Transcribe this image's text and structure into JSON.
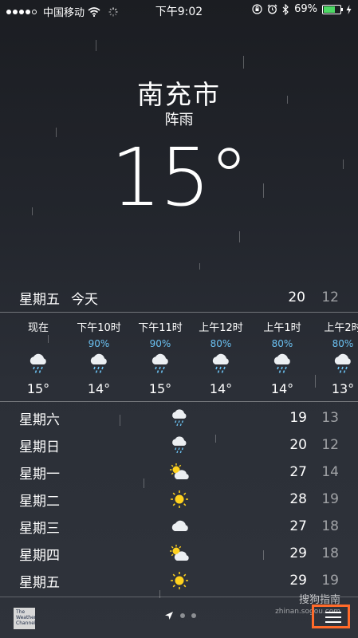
{
  "status": {
    "carrier": "中国移动",
    "time": "下午9:02",
    "battery": "69%",
    "battery_level": 0.69,
    "icons": [
      "signal-dots-icon",
      "wifi-icon",
      "activity-spinner-icon",
      "orientation-lock-icon",
      "alarm-icon",
      "bluetooth-icon",
      "battery-icon",
      "charging-bolt-icon"
    ]
  },
  "location": {
    "city": "南充市",
    "condition": "阵雨",
    "temp": "15°"
  },
  "today": {
    "day": "星期五",
    "label": "今天",
    "high": "20",
    "low": "12"
  },
  "hourly": [
    {
      "time": "现在",
      "precip": "",
      "icon": "rain-cloud-icon",
      "temp": "15°"
    },
    {
      "time": "下午10时",
      "precip": "90%",
      "icon": "rain-cloud-icon",
      "temp": "14°"
    },
    {
      "time": "下午11时",
      "precip": "90%",
      "icon": "rain-cloud-icon",
      "temp": "15°"
    },
    {
      "time": "上午12时",
      "precip": "80%",
      "icon": "rain-cloud-icon",
      "temp": "14°"
    },
    {
      "time": "上午1时",
      "precip": "80%",
      "icon": "rain-cloud-icon",
      "temp": "14°"
    },
    {
      "time": "上午2时",
      "precip": "80%",
      "icon": "rain-cloud-icon",
      "temp": "13°"
    }
  ],
  "daily": [
    {
      "day": "星期六",
      "icon": "rain-cloud-icon",
      "high": "19",
      "low": "13"
    },
    {
      "day": "星期日",
      "icon": "rain-cloud-icon",
      "high": "20",
      "low": "12"
    },
    {
      "day": "星期一",
      "icon": "partly-sunny-icon",
      "high": "27",
      "low": "14"
    },
    {
      "day": "星期二",
      "icon": "sun-icon",
      "high": "28",
      "low": "19"
    },
    {
      "day": "星期三",
      "icon": "cloud-icon",
      "high": "27",
      "low": "18"
    },
    {
      "day": "星期四",
      "icon": "partly-sunny-icon",
      "high": "29",
      "low": "18"
    },
    {
      "day": "星期五",
      "icon": "sun-icon",
      "high": "29",
      "low": "19"
    }
  ],
  "bottom": {
    "twc_line1": "The",
    "twc_line2": "Weather",
    "twc_line3": "Channel",
    "watermark": "搜狗指南",
    "watermark_url": "zhinan.sogou.com"
  },
  "colors": {
    "precip": "#6bc1f1",
    "highlight": "#ff6a2a",
    "sun": "#ffd21f"
  }
}
